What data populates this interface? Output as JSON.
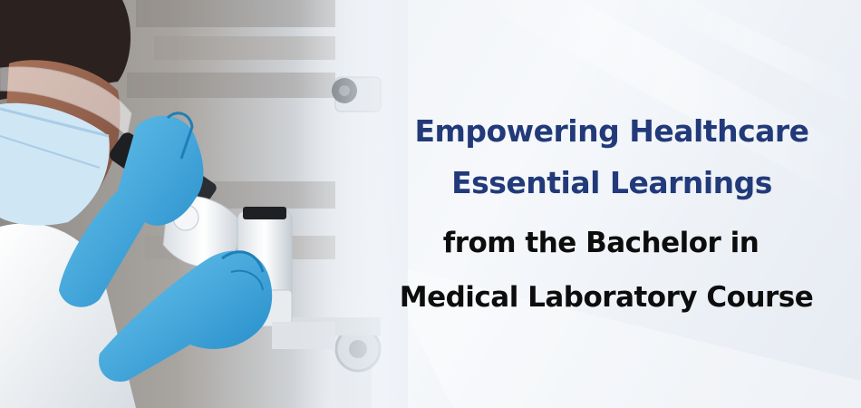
{
  "headline": {
    "line1": "Empowering Healthcare",
    "line2": "Essential Learnings",
    "line3": "from the Bachelor in",
    "line4": "Medical Laboratory Course"
  },
  "colors": {
    "accent_text": "#223a79",
    "dark_text": "#0d0d0d",
    "glove": "#3ea7dd",
    "coat": "#f3f5f7",
    "background": "#eef2f7"
  },
  "image": {
    "subject": "lab-technician-with-microscope-photo"
  }
}
